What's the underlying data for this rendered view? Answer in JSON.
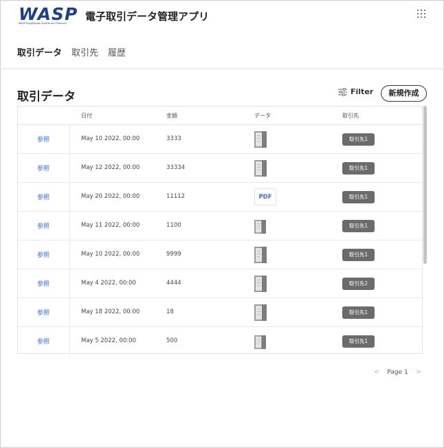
{
  "header": {
    "logo_text": "WASP",
    "logo_sub": "WASP Egypt/Japan Special and Products",
    "app_title": "電子取引データ管理アプリ",
    "nav": [
      {
        "label": "取引データ",
        "active": true
      },
      {
        "label": "取引先",
        "active": false
      },
      {
        "label": "履歴",
        "active": false
      }
    ]
  },
  "main": {
    "title": "取引データ",
    "filter_label": "Filter",
    "new_button_label": "新規作成",
    "columns": [
      "日付",
      "金額",
      "データ",
      "取引先"
    ],
    "rows": [
      {
        "ref": "参照",
        "date": "May 10 2022, 00:00",
        "amount": "3333",
        "data": "image",
        "partner": "取引先1"
      },
      {
        "ref": "参照",
        "date": "May 12 2022, 00:00",
        "amount": "33334",
        "data": "image",
        "partner": "取引先1"
      },
      {
        "ref": "参照",
        "date": "May 20 2022, 00:00",
        "amount": "11112",
        "data": "PDF",
        "partner": "取引先1"
      },
      {
        "ref": "参照",
        "date": "May 11 2022, 00:00",
        "amount": "1100",
        "data": "image-small",
        "partner": "取引先1"
      },
      {
        "ref": "参照",
        "date": "May 10 2022, 00:00",
        "amount": "9999",
        "data": "image",
        "partner": "取引先1"
      },
      {
        "ref": "参照",
        "date": "May 4 2022, 00:00",
        "amount": "4444",
        "data": "image",
        "partner": "取引先2"
      },
      {
        "ref": "参照",
        "date": "May 18 2022, 00:00",
        "amount": "18",
        "data": "image",
        "partner": "取引先1"
      },
      {
        "ref": "参照",
        "date": "May 5 2022, 00:00",
        "amount": "500",
        "data": "image-small",
        "partner": "取引先1"
      }
    ]
  },
  "pagination": {
    "label": "Page 1"
  },
  "colors": {
    "brand": "#1f3f8a",
    "link": "#3a6fd8",
    "tag_bg": "#6b6b6b"
  },
  "icons": [
    "apps-grid-icon",
    "filter-sliders-icon",
    "chevron-left-icon",
    "chevron-right-icon"
  ]
}
